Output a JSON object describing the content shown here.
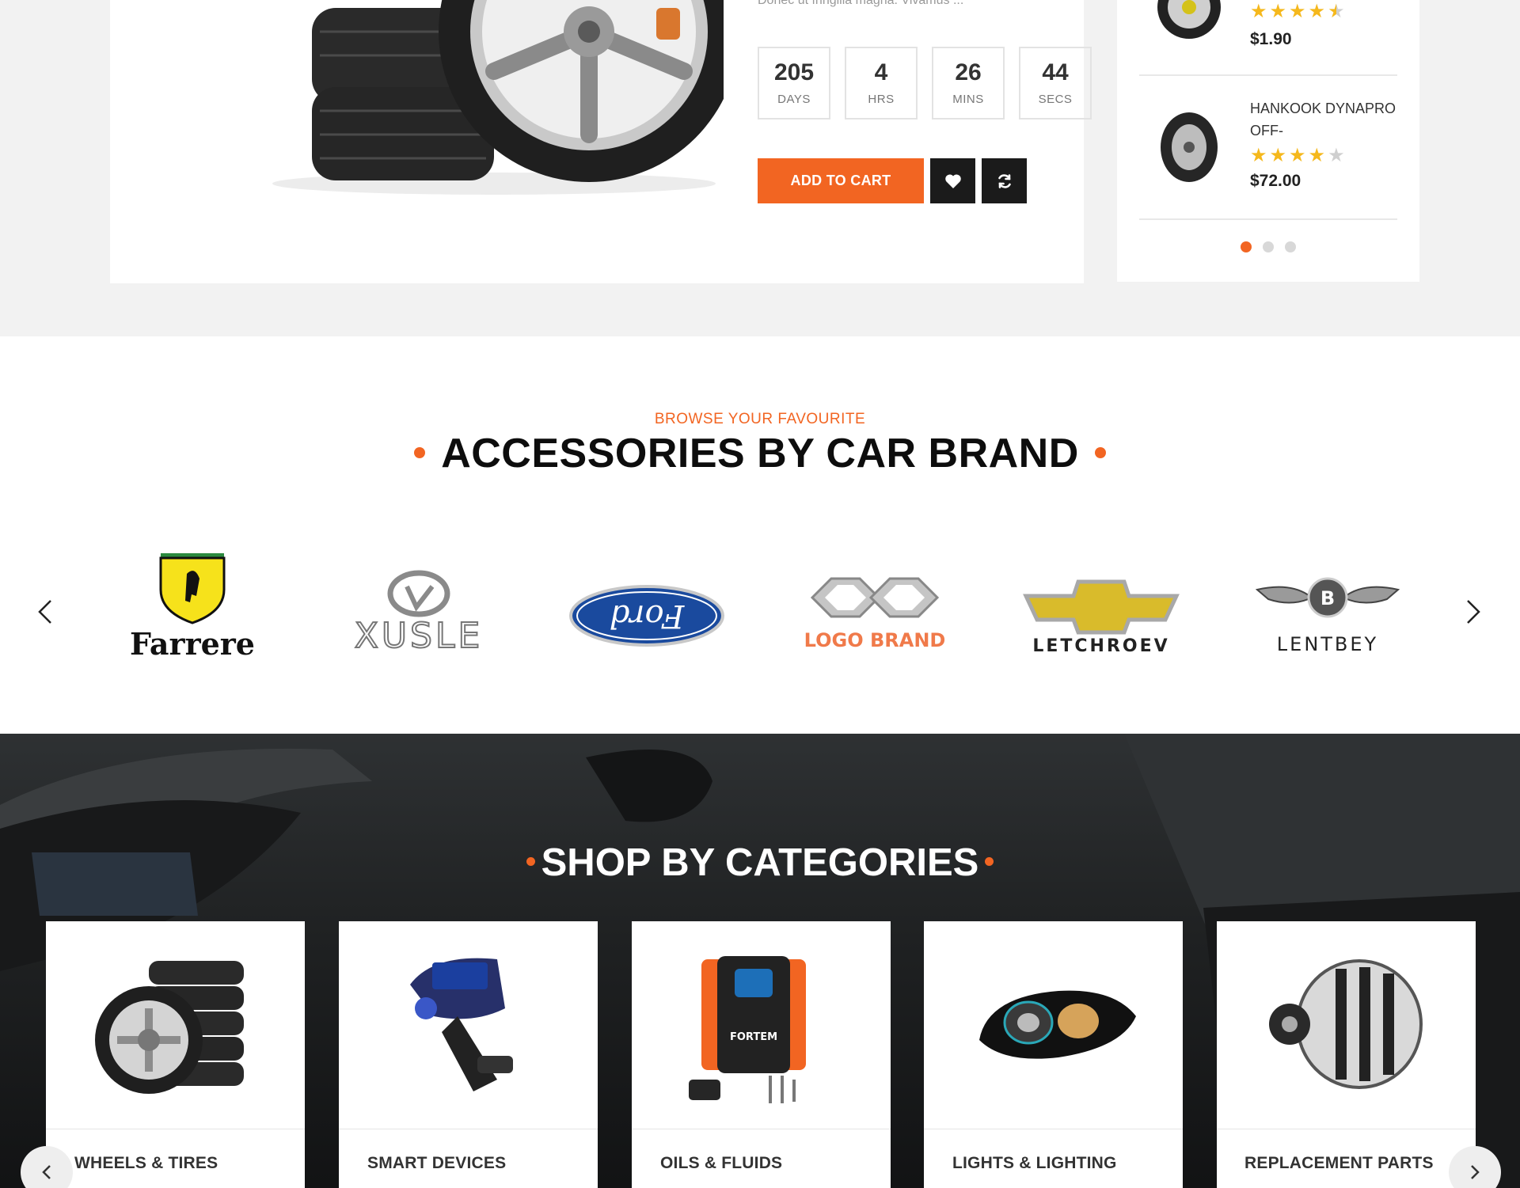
{
  "deal": {
    "description": "Donec ut fringilla magna. Vivamus ...",
    "countdown": [
      {
        "value": "205",
        "label": "DAYS"
      },
      {
        "value": "4",
        "label": "HRS"
      },
      {
        "value": "26",
        "label": "MINS"
      },
      {
        "value": "44",
        "label": "SECS"
      }
    ],
    "add_to_cart_label": "ADD TO CART",
    "wishlist_icon": "heart-icon",
    "compare_icon": "refresh-icon"
  },
  "side_products": {
    "items": [
      {
        "title": "",
        "rating": 4.5,
        "price": "$1.90"
      },
      {
        "title": "HANKOOK DYNAPRO OFF-",
        "rating": 4,
        "price": "$72.00"
      }
    ],
    "pager_pages": 3,
    "active_page": 1
  },
  "brands": {
    "subtitle": "BROWSE YOUR FAVOURITE",
    "title": "ACCESSORIES BY CAR BRAND",
    "logos": [
      {
        "text": "Farrere"
      },
      {
        "text": "XUSLE"
      },
      {
        "text": "Ford"
      },
      {
        "text": "LOGO BRAND"
      },
      {
        "text": "LETCHROEV"
      },
      {
        "text": "LENTBEY"
      }
    ]
  },
  "categories": {
    "title": "SHOP BY CATEGORIES",
    "items": [
      {
        "label": "WHEELS & TIRES"
      },
      {
        "label": "SMART DEVICES"
      },
      {
        "label": "OILS & FLUIDS"
      },
      {
        "label": "LIGHTS & LIGHTING"
      },
      {
        "label": "REPLACEMENT PARTS"
      }
    ]
  },
  "colors": {
    "accent": "#f26522",
    "dark": "#1b1b1b",
    "star": "#f5b81c"
  }
}
